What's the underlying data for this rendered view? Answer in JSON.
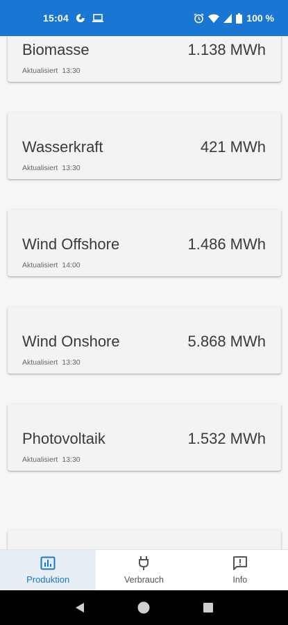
{
  "status_bar": {
    "time": "15:04",
    "battery_text": "100 %",
    "icons": [
      "data-saver-icon",
      "laptop-icon",
      "alarm-icon",
      "wifi-icon",
      "signal-icon",
      "battery-icon"
    ]
  },
  "cards": [
    {
      "name": "Biomasse",
      "value": "1.138 MWh",
      "updated_label": "Aktualisiert",
      "updated_time": "13:30"
    },
    {
      "name": "Wasserkraft",
      "value": "421 MWh",
      "updated_label": "Aktualisiert",
      "updated_time": "13:30"
    },
    {
      "name": "Wind Offshore",
      "value": "1.486 MWh",
      "updated_label": "Aktualisiert",
      "updated_time": "14:00"
    },
    {
      "name": "Wind Onshore",
      "value": "5.868 MWh",
      "updated_label": "Aktualisiert",
      "updated_time": "13:30"
    },
    {
      "name": "Photovoltaik",
      "value": "1.532 MWh",
      "updated_label": "Aktualisiert",
      "updated_time": "13:30"
    }
  ],
  "bottom_nav": {
    "items": [
      {
        "label": "Produktion",
        "icon": "bar-chart-icon",
        "active": true
      },
      {
        "label": "Verbrauch",
        "icon": "plug-icon",
        "active": false
      },
      {
        "label": "Info",
        "icon": "feedback-icon",
        "active": false
      }
    ]
  },
  "colors": {
    "primary": "#1976d2",
    "background": "#f6f6f6",
    "card": "#f3f3f3"
  }
}
